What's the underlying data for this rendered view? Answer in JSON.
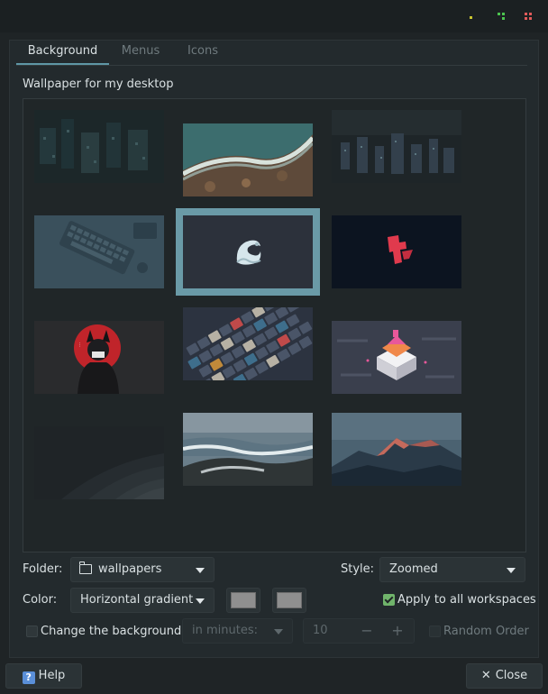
{
  "tabs": [
    {
      "label": "Background",
      "active": true
    },
    {
      "label": "Menus",
      "active": false
    },
    {
      "label": "Icons",
      "active": false
    }
  ],
  "section_label": "Wallpaper for my desktop",
  "wallpapers": [
    {
      "name": "dark-city-blur"
    },
    {
      "name": "aerial-ocean-waves"
    },
    {
      "name": "night-city-lights"
    },
    {
      "name": "keyboard-desk-blue"
    },
    {
      "name": "wave-logo-dark",
      "selected": true
    },
    {
      "name": "red-logo-dark"
    },
    {
      "name": "anime-girl-red-circle"
    },
    {
      "name": "mechanical-keyboard-keys"
    },
    {
      "name": "isometric-house"
    },
    {
      "name": "abstract-dark-curves"
    },
    {
      "name": "rocky-ocean-shore"
    },
    {
      "name": "mountain-sunset"
    }
  ],
  "folder": {
    "label": "Folder:",
    "value": "wallpapers",
    "icon": "folder-icon"
  },
  "style": {
    "label": "Style:",
    "value": "Zoomed"
  },
  "color": {
    "label": "Color:",
    "value": "Horizontal gradient",
    "swatch1": "#8f8f8f",
    "swatch2": "#8f8f8f"
  },
  "apply_all": {
    "label": "Apply to all workspaces",
    "checked": true
  },
  "change_bg": {
    "label": "Change the background",
    "checked": false
  },
  "interval": {
    "value": "in minutes:",
    "amount": "10",
    "minus": "−",
    "plus": "+"
  },
  "random_order": {
    "label": "Random Order",
    "checked": false
  },
  "buttons": {
    "help": "Help",
    "close": "Close",
    "help_icon": "?",
    "close_icon": "✕"
  },
  "colors": {
    "accent": "#5f97a6",
    "selected_outline": "#6a9aa7",
    "check_on": "#70b46b"
  }
}
